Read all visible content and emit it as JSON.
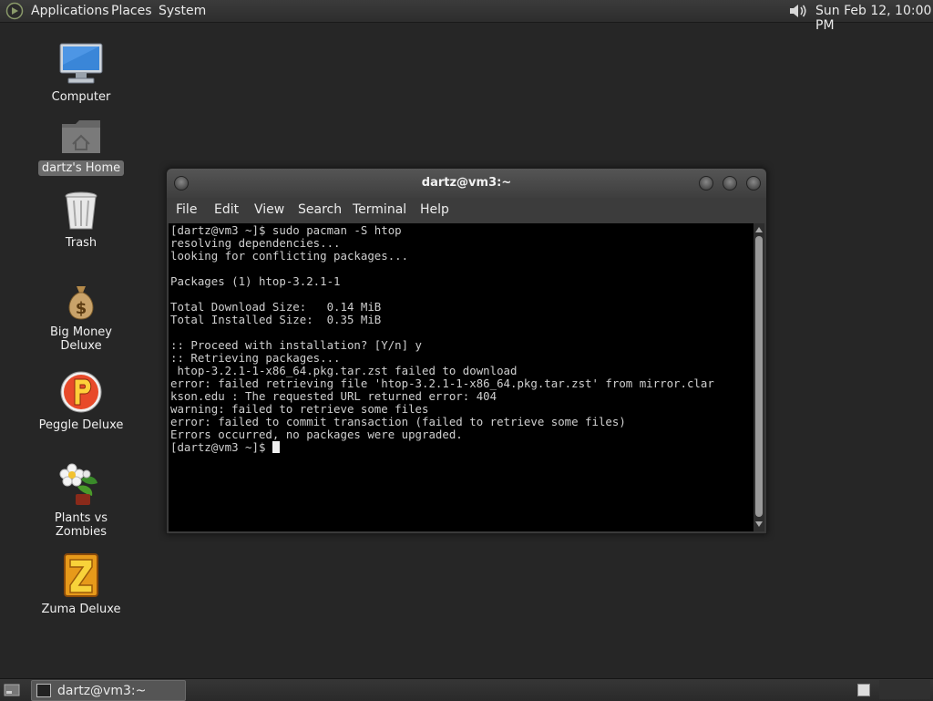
{
  "top_panel": {
    "menus": [
      "Applications",
      "Places",
      "System"
    ],
    "clock": "Sun Feb 12, 10:00 PM"
  },
  "desktop": {
    "icons": [
      {
        "label": "Computer",
        "icon": "computer-icon"
      },
      {
        "label": "dartz's Home",
        "icon": "home-folder-icon",
        "selected": true
      },
      {
        "label": "Trash",
        "icon": "trash-icon"
      },
      {
        "label": "Big Money Deluxe",
        "icon": "money-bag-icon"
      },
      {
        "label": "Peggle Deluxe",
        "icon": "peggle-icon"
      },
      {
        "label": "Plants vs Zombies",
        "icon": "flower-icon"
      },
      {
        "label": "Zuma Deluxe",
        "icon": "zuma-icon"
      }
    ]
  },
  "terminal": {
    "title": "dartz@vm3:~",
    "menu": [
      "File",
      "Edit",
      "View",
      "Search",
      "Terminal",
      "Help"
    ],
    "lines": [
      "[dartz@vm3 ~]$ sudo pacman -S htop",
      "resolving dependencies...",
      "looking for conflicting packages...",
      "",
      "Packages (1) htop-3.2.1-1",
      "",
      "Total Download Size:   0.14 MiB",
      "Total Installed Size:  0.35 MiB",
      "",
      ":: Proceed with installation? [Y/n] y",
      ":: Retrieving packages...",
      " htop-3.2.1-1-x86_64.pkg.tar.zst failed to download",
      "error: failed retrieving file 'htop-3.2.1-1-x86_64.pkg.tar.zst' from mirror.clar",
      "kson.edu : The requested URL returned error: 404",
      "warning: failed to retrieve some files",
      "error: failed to commit transaction (failed to retrieve some files)",
      "Errors occurred, no packages were upgraded."
    ],
    "prompt": "[dartz@vm3 ~]$ "
  },
  "bottom_panel": {
    "task_label": "dartz@vm3:~"
  },
  "colors": {
    "desktop_bg": "#262626",
    "terminal_bg": "#000000",
    "terminal_fg": "#cfcfcf"
  }
}
